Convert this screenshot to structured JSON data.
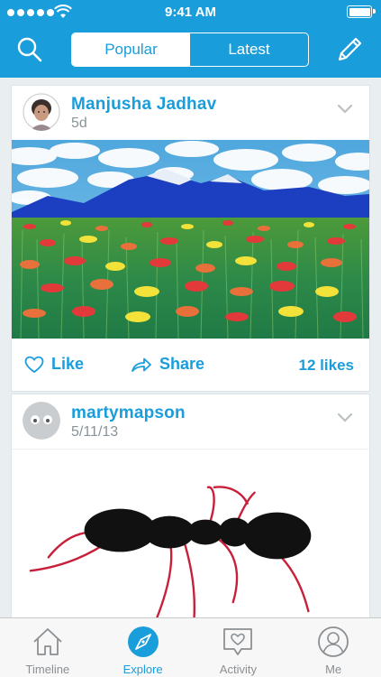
{
  "status": {
    "time": "9:41 AM"
  },
  "header": {
    "segments": [
      {
        "label": "Popular",
        "active": true
      },
      {
        "label": "Latest",
        "active": false
      }
    ]
  },
  "posts": [
    {
      "author": "Manjusha Jadhav",
      "age": "5d",
      "like_label": "Like",
      "share_label": "Share",
      "likes": "12 likes",
      "image": "painting-flower-field-mountains"
    },
    {
      "author": "martymapson",
      "age": "5/11/13",
      "image": "drawing-red-ant"
    }
  ],
  "tabbar": {
    "items": [
      {
        "label": "Timeline",
        "icon": "house-icon",
        "active": false
      },
      {
        "label": "Explore",
        "icon": "compass-icon",
        "active": true
      },
      {
        "label": "Activity",
        "icon": "heart-bubble-icon",
        "active": false
      },
      {
        "label": "Me",
        "icon": "person-icon",
        "active": false
      }
    ]
  },
  "colors": {
    "accent": "#1a9ddb",
    "background": "#e9eef0",
    "tab_inactive": "#8b8f92"
  }
}
